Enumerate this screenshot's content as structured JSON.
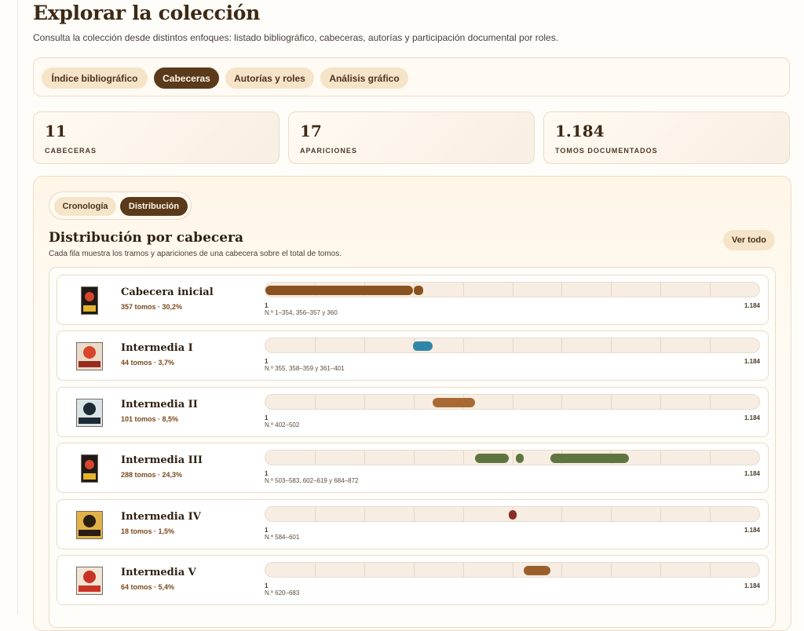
{
  "page": {
    "title": "Explorar la colección",
    "subtitle": "Consulta la colección desde distintos enfoques: listado bibliográfico, cabeceras, autorías y participación documental por roles."
  },
  "tabs": [
    "Índice bibliográfico",
    "Cabeceras",
    "Autorías y roles",
    "Análisis gráfico"
  ],
  "active_tab": "Cabeceras",
  "stats": [
    {
      "value": "11",
      "label": "CABECERAS"
    },
    {
      "value": "17",
      "label": "APARICIONES"
    },
    {
      "value": "1.184",
      "label": "TOMOS DOCUMENTADOS"
    }
  ],
  "subtabs": [
    "Cronología",
    "Distribución"
  ],
  "active_subtab": "Distribución",
  "section": {
    "title": "Distribución por cabecera",
    "subtitle": "Cada fila muestra los tramos y apariciones de una cabecera sobre el total de tomos.",
    "see_all": "Ver todo"
  },
  "axis": {
    "min": 1,
    "max": 1184,
    "min_label": "1",
    "max_label": "1.184"
  },
  "colors": {
    "accent": "#5a3a1a",
    "pill": "#f6e4c9",
    "ink": "#3d2914"
  },
  "rows": [
    {
      "name": "Cabecera inicial",
      "meta": "357 tomos · 30,2%",
      "ranges": "N.º 1–354, 356–357 y 360",
      "color": "#8a521e",
      "icon": "cover-punto-rojo-inicial",
      "segments": [
        [
          1,
          354
        ],
        [
          356,
          357
        ],
        [
          360,
          360
        ]
      ]
    },
    {
      "name": "Intermedia I",
      "meta": "44 tomos · 3,7%",
      "ranges": "N.º 355, 358–359 y 361–401",
      "color": "#2f86a8",
      "icon": "cover-punto-rojo-1",
      "segments": [
        [
          355,
          355
        ],
        [
          358,
          359
        ],
        [
          361,
          401
        ]
      ]
    },
    {
      "name": "Intermedia II",
      "meta": "101 tomos · 8,5%",
      "ranges": "N.º 402–502",
      "color": "#a86a35",
      "icon": "cover-punto-rojo-2",
      "segments": [
        [
          402,
          502
        ]
      ]
    },
    {
      "name": "Intermedia III",
      "meta": "288 tomos · 24,3%",
      "ranges": "N.º 503–583, 602–619 y 684–872",
      "color": "#5f7540",
      "icon": "cover-punto-rojo-3",
      "segments": [
        [
          503,
          583
        ],
        [
          602,
          619
        ],
        [
          684,
          872
        ]
      ]
    },
    {
      "name": "Intermedia IV",
      "meta": "18 tomos · 1,5%",
      "ranges": "N.º 584–601",
      "color": "#8a2e22",
      "icon": "cover-punto-rojo-4",
      "segments": [
        [
          584,
          601
        ]
      ]
    },
    {
      "name": "Intermedia V",
      "meta": "64 tomos · 5,4%",
      "ranges": "N.º 620–683",
      "color": "#9b5f2c",
      "icon": "cover-punto-rojo-5",
      "segments": [
        [
          620,
          683
        ]
      ]
    }
  ]
}
